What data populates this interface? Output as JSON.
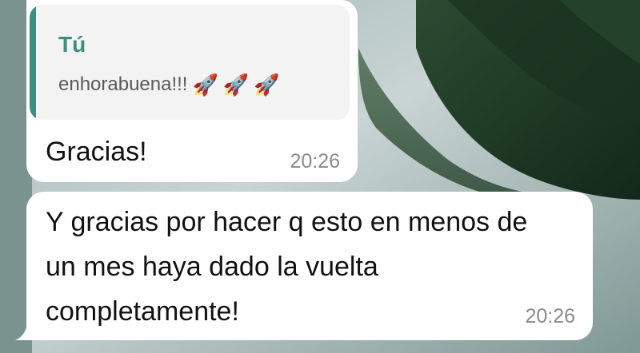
{
  "chat": {
    "messages": [
      {
        "reply_to": {
          "author": "Tú",
          "text": "enhorabuena!!!",
          "emojis": [
            "🚀",
            "🚀",
            "🚀"
          ]
        },
        "text": "Gracias!",
        "time": "20:26"
      },
      {
        "text": "Y gracias por hacer q esto en menos de un mes haya dado la vuelta completamente!",
        "time": "20:26"
      }
    ]
  },
  "colors": {
    "bubble": "#ffffff",
    "quote_accent": "#3f8c80",
    "quote_background": "#f3f3f3",
    "timestamp": "#8a8a8a",
    "text": "#111111"
  },
  "icons": {
    "reaction_emoji": "rocket"
  }
}
